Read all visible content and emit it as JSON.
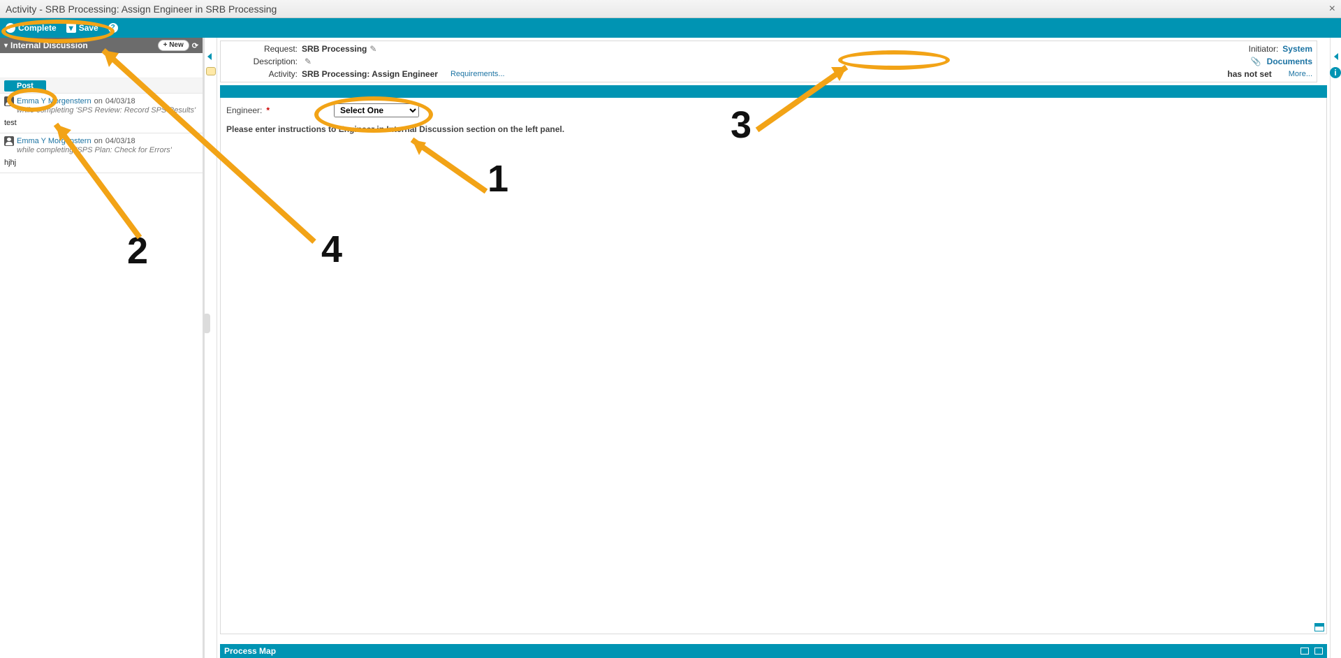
{
  "window": {
    "title": "Activity - SRB Processing: Assign Engineer in SRB Processing"
  },
  "toolbar": {
    "complete": "Complete",
    "save": "Save"
  },
  "sidebar": {
    "title": "Internal Discussion",
    "new_btn": "+ New",
    "post_btn": "Post",
    "messages": [
      {
        "author": "Emma Y Morgenstern",
        "on_label": "on",
        "date": "04/03/18",
        "context": "while completing 'SPS Review: Record SPS Results'",
        "body": "test"
      },
      {
        "author": "Emma Y Morgenstern",
        "on_label": "on",
        "date": "04/03/18",
        "context": "while completing 'SPS Plan: Check for Errors'",
        "body": "hjhj"
      }
    ]
  },
  "header": {
    "request_lbl": "Request:",
    "request_val": "SRB Processing",
    "description_lbl": "Description:",
    "activity_lbl": "Activity:",
    "activity_val": "SRB Processing: Assign Engineer",
    "requirements": "Requirements...",
    "initiator_lbl": "Initiator:",
    "initiator_val": "System",
    "documents": "Documents",
    "deadline_txt": "has not set",
    "more": "More..."
  },
  "form": {
    "engineer_lbl": "Engineer:",
    "engineer_select": "Select One",
    "instructions": "Please enter instructions to Engineer in Internal Discussion section on the left panel."
  },
  "process_map": {
    "title": "Process Map"
  },
  "annotations": {
    "n1": "1",
    "n2": "2",
    "n3": "3",
    "n4": "4"
  }
}
